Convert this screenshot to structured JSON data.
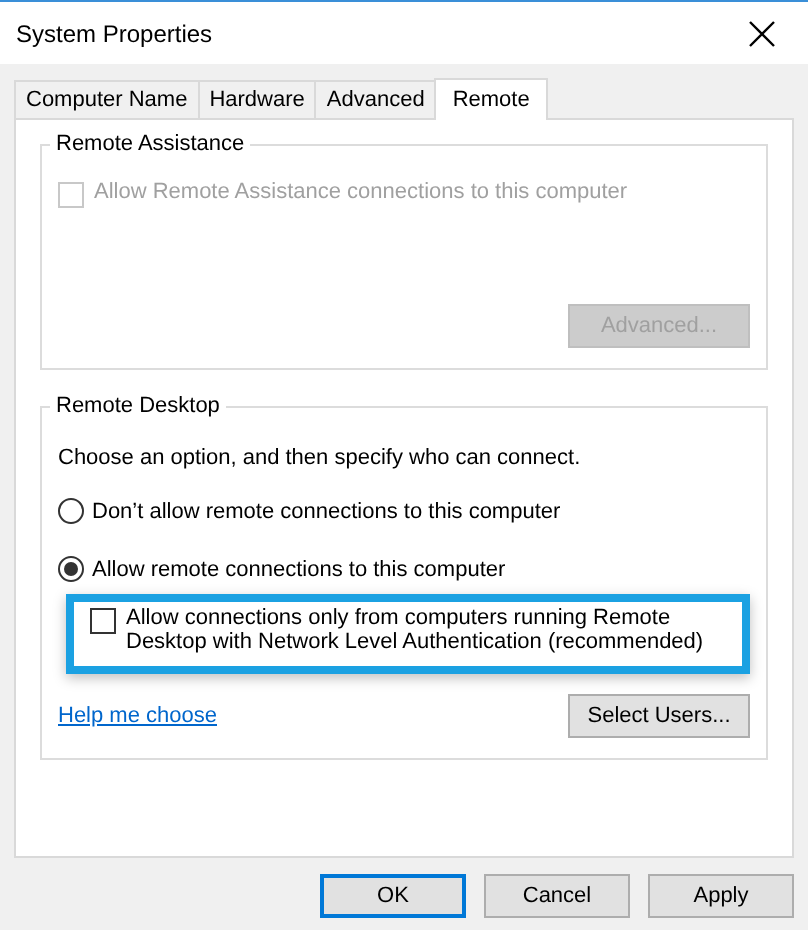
{
  "window": {
    "title": "System Properties"
  },
  "tabs": [
    {
      "label": "Computer Name",
      "selected": false
    },
    {
      "label": "Hardware",
      "selected": false
    },
    {
      "label": "Advanced",
      "selected": false
    },
    {
      "label": "Remote",
      "selected": true
    }
  ],
  "remote_assistance": {
    "title": "Remote Assistance",
    "checkbox": {
      "label": "Allow Remote Assistance connections to this computer",
      "checked": false,
      "disabled": true
    },
    "button": {
      "label": "Advanced...",
      "disabled": true
    }
  },
  "remote_desktop": {
    "title": "Remote Desktop",
    "instruction": "Choose an option, and then specify who can connect.",
    "options": [
      {
        "label": "Don’t allow remote connections to this computer",
        "selected": false
      },
      {
        "label": "Allow remote connections to this computer",
        "selected": true
      }
    ],
    "nla_checkbox": {
      "label": "Allow connections only from computers running Remote Desktop with Network Level Authentication (recommended)",
      "checked": false,
      "highlighted": true
    },
    "help_link": "Help me choose",
    "button": {
      "label": "Select Users...",
      "disabled": false
    }
  },
  "buttons": [
    {
      "label": "OK",
      "default": true
    },
    {
      "label": "Cancel",
      "default": false
    },
    {
      "label": "Apply",
      "default": false
    }
  ]
}
